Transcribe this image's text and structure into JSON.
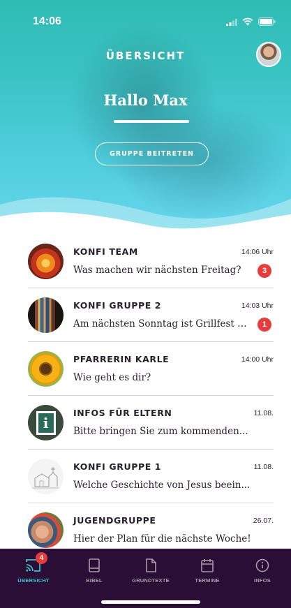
{
  "status_bar": {
    "time": "14:06"
  },
  "header": {
    "title": "ÜBERSICHT",
    "greeting": "Hallo Max",
    "join_button": "GRUPPE BEITRETEN"
  },
  "chats": [
    {
      "name": "KONFI TEAM",
      "time": "14:06 Uhr",
      "message": "Was machen wir nächsten Freitag?",
      "unread": "3",
      "image": "lantern-image"
    },
    {
      "name": "KONFI GRUPPE 2",
      "time": "14:03 Uhr",
      "message": "Am nächsten Sonntag ist Grillfest n...",
      "unread": "1",
      "image": "church-window-image"
    },
    {
      "name": "PFARRERIN KARLE",
      "time": "14:00 Uhr",
      "message": "Wie geht es dir?",
      "unread": "",
      "image": "sunflower-image"
    },
    {
      "name": "INFOS FÜR ELTERN",
      "time": "11.08.",
      "message": "Bitte bringen Sie zum kommenden...",
      "unread": "",
      "image": "info-sign-image"
    },
    {
      "name": "KONFI GRUPPE 1",
      "time": "11.08.",
      "message": "Welche Geschichte von Jesus beein...",
      "unread": "",
      "image": "church-sketch-image"
    },
    {
      "name": "JUGENDGRUPPE",
      "time": "26.07.",
      "message": "Hier der Plan für die nächste Woche!",
      "unread": "",
      "image": "hands-image"
    }
  ],
  "tabbar": {
    "tabs": [
      {
        "label": "ÜBERSICHT",
        "icon": "cast-icon",
        "badge": "4"
      },
      {
        "label": "BIBEL",
        "icon": "book-icon"
      },
      {
        "label": "GRUNDTEXTE",
        "icon": "document-icon"
      },
      {
        "label": "TERMINE",
        "icon": "calendar-icon"
      },
      {
        "label": "INFOS",
        "icon": "info-icon"
      }
    ]
  },
  "colors": {
    "accent": "#39c3c9",
    "tabbar_bg": "#2b0e35",
    "badge": "#e63c3c",
    "text": "#2a1f2d"
  }
}
